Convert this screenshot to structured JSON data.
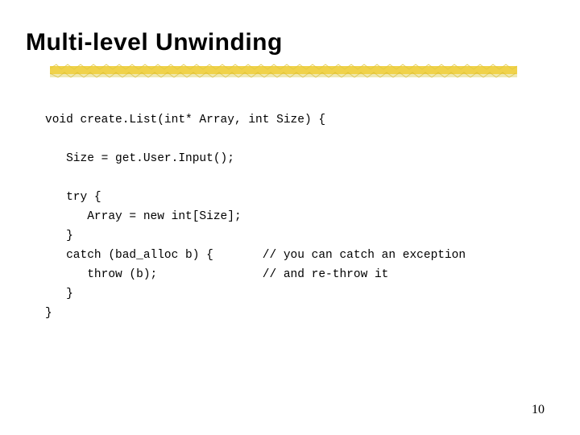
{
  "slide": {
    "title": "Multi-level Unwinding",
    "page_number": "10",
    "code": "void create.List(int* Array, int Size) {\n\n   Size = get.User.Input();\n\n   try {\n      Array = new int[Size];\n   }\n   catch (bad_alloc b) {       // you can catch an exception\n      throw (b);               // and re-throw it\n   }\n}"
  }
}
